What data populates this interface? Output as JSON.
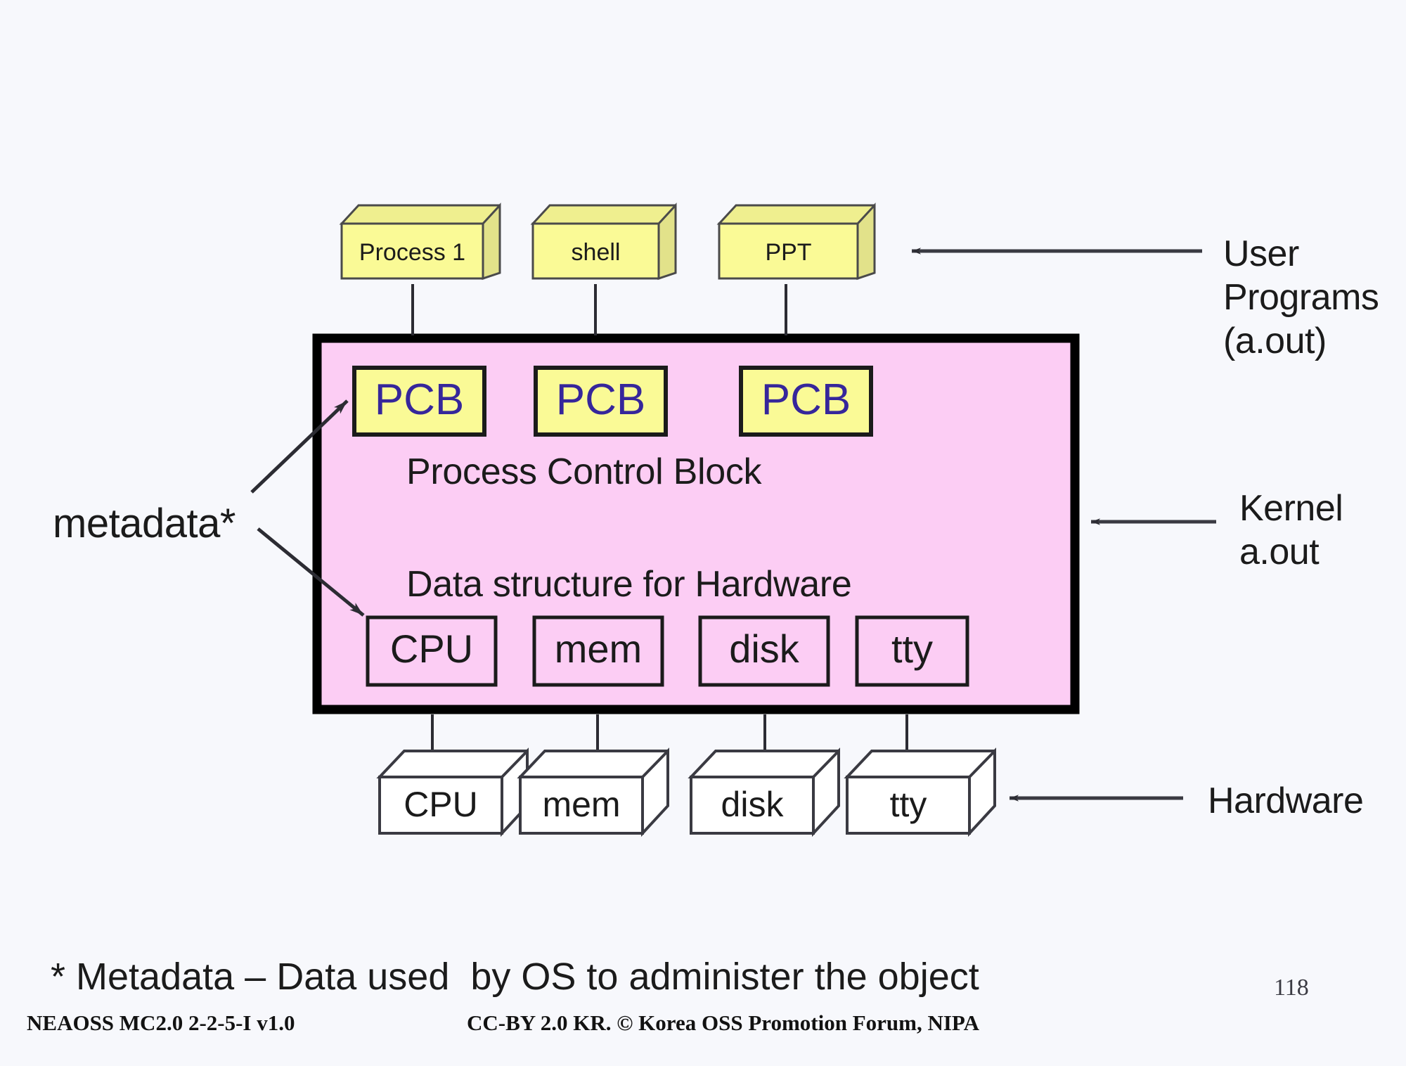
{
  "slide": {
    "page_number": "118",
    "footnote": "* Metadata – Data used  by OS to administer the object",
    "credit_left": "NEAOSS MC2.0 2-2-5-I v1.0",
    "credit_center": "CC-BY 2.0 KR. © Korea OSS Promotion Forum, NIPA"
  },
  "colors": {
    "background": "#F7F8FC",
    "kernel_fill": "#FCCDF4",
    "kernel_border": "#000000",
    "user_box_fill": "#FAFA96",
    "user_box_side": "#E2E28A",
    "pcb_fill": "#FAFA96",
    "pcb_text": "#36269B",
    "hardware_fill": "#FFFFFF",
    "line": "#3a3a42"
  },
  "user_programs": {
    "boxes": [
      {
        "label": "Process 1"
      },
      {
        "label": "shell"
      },
      {
        "label": "PPT"
      }
    ],
    "annotation": [
      "User",
      "Programs",
      "(a.out)"
    ]
  },
  "kernel": {
    "annotation": [
      "Kernel",
      "a.out"
    ],
    "pcb_blocks": [
      {
        "label": "PCB"
      },
      {
        "label": "PCB"
      },
      {
        "label": "PCB"
      }
    ],
    "pcb_caption": "Process Control Block",
    "data_structure_caption": "Data structure for Hardware",
    "data_structures": [
      {
        "label": "CPU"
      },
      {
        "label": "mem"
      },
      {
        "label": "disk"
      },
      {
        "label": "tty"
      }
    ]
  },
  "hardware": {
    "annotation": [
      "Hardware"
    ],
    "devices": [
      {
        "label": "CPU"
      },
      {
        "label": "mem"
      },
      {
        "label": "disk"
      },
      {
        "label": "tty"
      }
    ]
  },
  "metadata": {
    "label": "metadata*"
  }
}
